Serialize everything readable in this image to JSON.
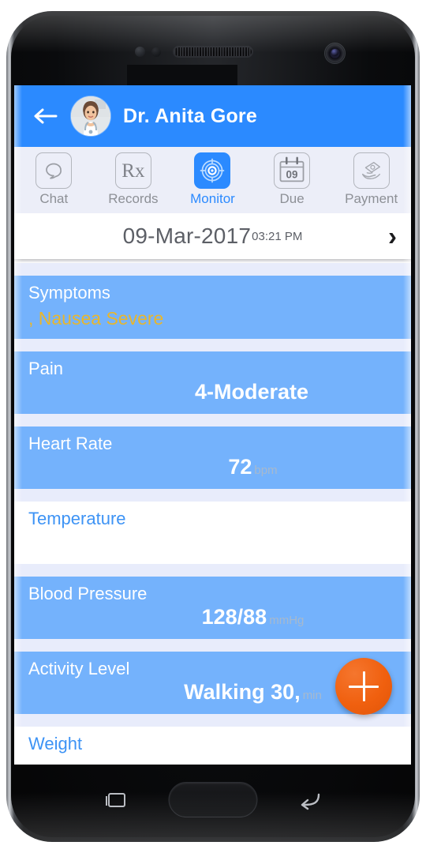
{
  "app": {
    "header": {
      "back_icon": "back-arrow-icon",
      "avatar_alt": "doctor-avatar",
      "doctor_name": "Dr. Anita Gore",
      "bar_color": "#2b8aff"
    },
    "tabs": [
      {
        "label": "Chat",
        "icon": "chat-bubble-icon",
        "active": false
      },
      {
        "label": "Records",
        "icon": "rx-icon",
        "active": false,
        "glyph": "Rx"
      },
      {
        "label": "Monitor",
        "icon": "target-monitor-icon",
        "active": true
      },
      {
        "label": "Due",
        "icon": "calendar-icon",
        "active": false,
        "glyph": "09"
      },
      {
        "label": "Payment",
        "icon": "payment-hand-icon",
        "active": false
      }
    ],
    "date_bar": {
      "date": "09-Mar-2017",
      "time": "03:21 PM",
      "next_icon": "chevron-right-icon"
    },
    "vitals": [
      {
        "label": "Symptoms",
        "subvalue": ", Nausea Severe",
        "value": "",
        "unit": "",
        "filled": true
      },
      {
        "label": "Pain",
        "subvalue": "",
        "value": "4-Moderate",
        "unit": "",
        "filled": true
      },
      {
        "label": "Heart Rate",
        "subvalue": "",
        "value": "72",
        "unit": "bpm",
        "filled": true
      },
      {
        "label": "Temperature",
        "subvalue": "",
        "value": "",
        "unit": "",
        "filled": false
      },
      {
        "label": "Blood Pressure",
        "subvalue": "",
        "value": "128/88",
        "unit": "mmHg",
        "filled": true
      },
      {
        "label": "Activity Level",
        "subvalue": "",
        "value": "Walking 30,",
        "unit": "min",
        "filled": true
      },
      {
        "label": "Weight",
        "subvalue": "",
        "value": "",
        "unit": "",
        "filled": false
      }
    ],
    "fab": {
      "icon": "plus-icon",
      "color": "#f0600f"
    },
    "colors": {
      "accent_blue": "#2b8aff",
      "row_blue": "#74b2fc",
      "divider": "#e8ecfb",
      "symptom_gold": "#e8b62c",
      "fab_orange": "#f0600f"
    }
  },
  "device": {
    "nav": [
      {
        "name": "recents-button",
        "icon": "recents-icon"
      },
      {
        "name": "home-button",
        "icon": "home-icon"
      },
      {
        "name": "back-button",
        "icon": "back-icon"
      }
    ]
  }
}
